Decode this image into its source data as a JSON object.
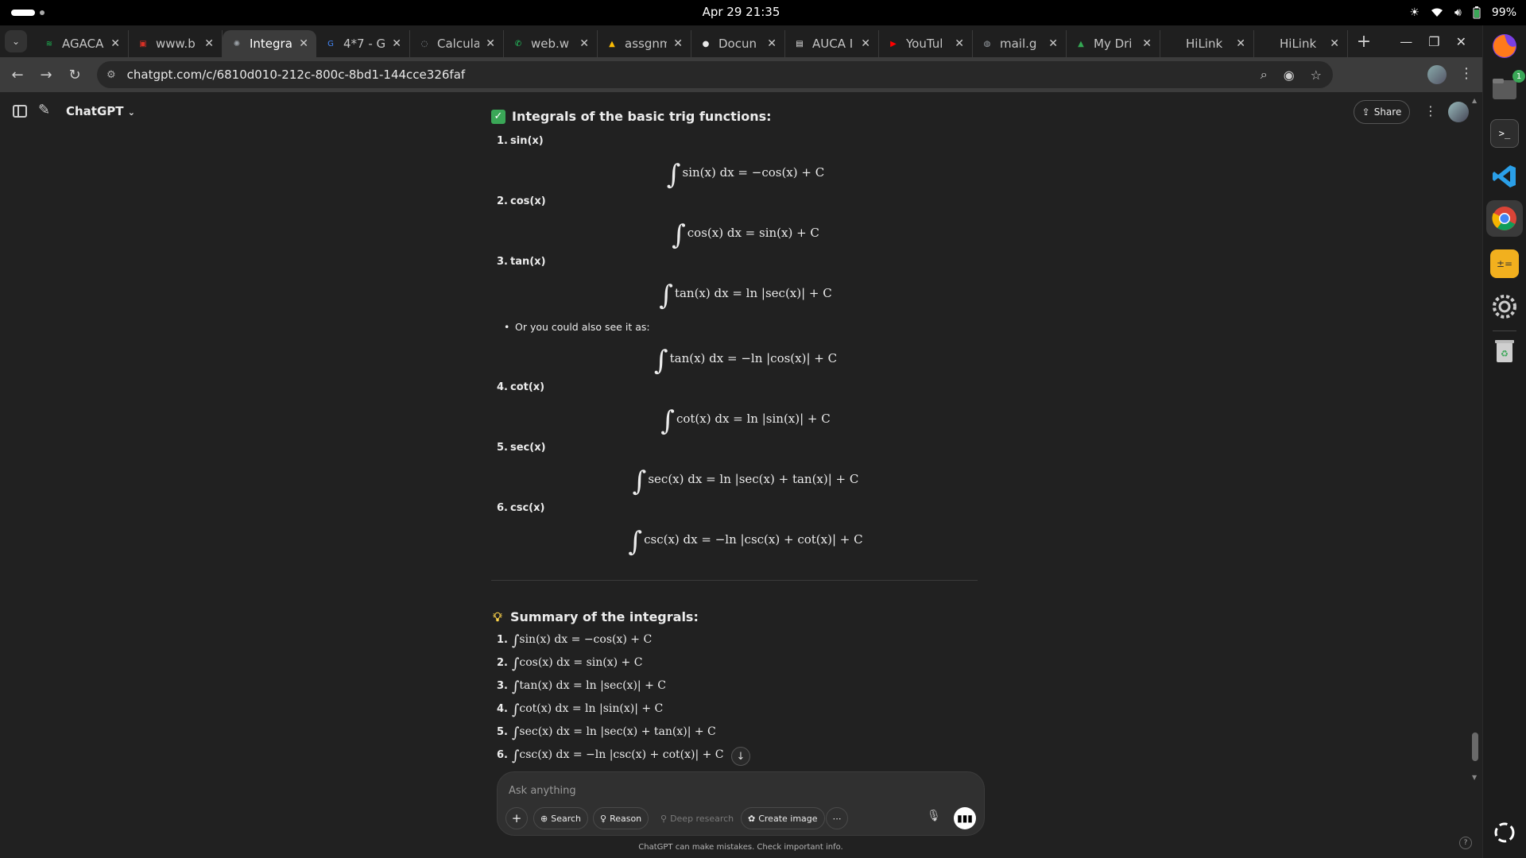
{
  "system": {
    "clock": "Apr 29  21:35",
    "battery": "99%"
  },
  "browser": {
    "tabs": [
      {
        "label": "AGACA",
        "icon": "spotify-icon",
        "color": "#1db954"
      },
      {
        "label": "www.b",
        "icon": "bookmark-icon",
        "color": "#d93025"
      },
      {
        "label": "Integra",
        "icon": "chatgpt-icon",
        "color": "#9aa0a6",
        "active": true
      },
      {
        "label": "4*7 - G",
        "icon": "google-icon",
        "color": "#4285f4"
      },
      {
        "label": "Calcula",
        "icon": "loading-icon",
        "color": "#9aa0a6"
      },
      {
        "label": "web.w",
        "icon": "whatsapp-icon",
        "color": "#25d366"
      },
      {
        "label": "assgnm",
        "icon": "drive-icon",
        "color": "#fbbc04"
      },
      {
        "label": "Docun",
        "icon": "github-icon",
        "color": "#e8e8e8"
      },
      {
        "label": "AUCA I",
        "icon": "document-icon",
        "color": "#e8e8e8"
      },
      {
        "label": "YouTul",
        "icon": "youtube-icon",
        "color": "#ff0000"
      },
      {
        "label": "mail.g",
        "icon": "globe-icon",
        "color": "#9aa0a6"
      },
      {
        "label": "My Dri",
        "icon": "drive-icon",
        "color": "#34a853"
      },
      {
        "label": "HiLink",
        "icon": "",
        "color": "#9aa0a6"
      },
      {
        "label": "HiLink",
        "icon": "",
        "color": "#9aa0a6"
      }
    ],
    "url": "chatgpt.com/c/6810d010-212c-800c-8bd1-144cce326faf"
  },
  "chat": {
    "model_name": "ChatGPT",
    "share_label": "Share"
  },
  "content": {
    "section1_title": "Integrals of the basic trig functions:",
    "items": [
      {
        "num": "1.",
        "label": "sin(x)",
        "formula": "sin(x) dx = −cos(x) + C"
      },
      {
        "num": "2.",
        "label": "cos(x)",
        "formula": "cos(x) dx = sin(x) + C"
      },
      {
        "num": "3.",
        "label": "tan(x)",
        "formula": "tan(x) dx = ln |sec(x)| + C"
      },
      {
        "num": "4.",
        "label": "cot(x)",
        "formula": "cot(x) dx = ln |sin(x)| + C"
      },
      {
        "num": "5.",
        "label": "sec(x)",
        "formula": "sec(x) dx = ln |sec(x) + tan(x)| + C"
      },
      {
        "num": "6.",
        "label": "csc(x)",
        "formula": "csc(x) dx = −ln |csc(x) + cot(x)| + C"
      }
    ],
    "alt_bullet": "Or you could also see it as:",
    "alt_formula": "tan(x) dx = −ln |cos(x)| + C",
    "section2_title": "Summary of the integrals:",
    "summary": [
      {
        "num": "1.",
        "formula": "sin(x) dx = −cos(x) + C"
      },
      {
        "num": "2.",
        "formula": "cos(x) dx = sin(x) + C"
      },
      {
        "num": "3.",
        "formula": "tan(x) dx = ln |sec(x)| + C"
      },
      {
        "num": "4.",
        "formula": "cot(x) dx = ln |sin(x)| + C"
      },
      {
        "num": "5.",
        "formula": "sec(x) dx = ln |sec(x) + tan(x)| + C"
      },
      {
        "num": "6.",
        "formula": "csc(x) dx = −ln |csc(x) + cot(x)| + C"
      }
    ]
  },
  "composer": {
    "placeholder": "Ask anything",
    "search_label": "Search",
    "reason_label": "Reason",
    "deep_research_label": "Deep research",
    "create_image_label": "Create image",
    "disclaimer": "ChatGPT can make mistakes. Check important info."
  },
  "dock": {
    "files_badge": "1"
  }
}
